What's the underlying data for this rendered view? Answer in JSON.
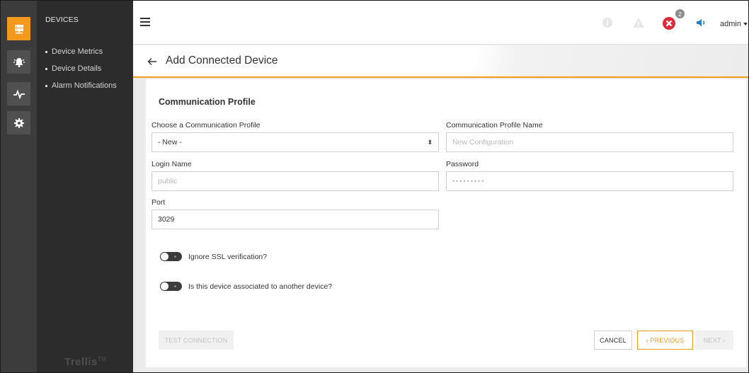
{
  "sidebar": {
    "title": "DEVICES",
    "items": [
      {
        "label": "Device Metrics"
      },
      {
        "label": "Device Details"
      },
      {
        "label": "Alarm Notifications"
      }
    ],
    "logo": "Trellis",
    "logo_mark": "TM"
  },
  "rail": {
    "items": [
      {
        "icon": "devices-icon",
        "active": true
      },
      {
        "icon": "alarm-bell-icon",
        "active": false
      },
      {
        "icon": "pulse-icon",
        "active": false
      },
      {
        "icon": "gear-icon",
        "active": false
      }
    ]
  },
  "topbar": {
    "notification_count": "2",
    "user": "admin"
  },
  "header": {
    "title": "Add Connected Device"
  },
  "form": {
    "section_title": "Communication Profile",
    "profile_label": "Choose a Communication Profile",
    "profile_value": "- New -",
    "profile_name_label": "Communication Profile Name",
    "profile_name_placeholder": "New Configuration",
    "login_label": "Login Name",
    "login_placeholder": "public",
    "password_label": "Password",
    "password_placeholder": "•••••••••",
    "port_label": "Port",
    "port_value": "3029",
    "toggle_ssl_label": "Ignore SSL verification?",
    "toggle_assoc_label": "Is this device associated to another device?"
  },
  "buttons": {
    "test_connection": "TEST CONNECTION",
    "cancel": "CANCEL",
    "previous": "‹ PREVIOUS",
    "next": "NEXT ›"
  },
  "colors": {
    "accent": "#f39a1e",
    "error": "#e0293a",
    "info": "#2a7fc0"
  }
}
